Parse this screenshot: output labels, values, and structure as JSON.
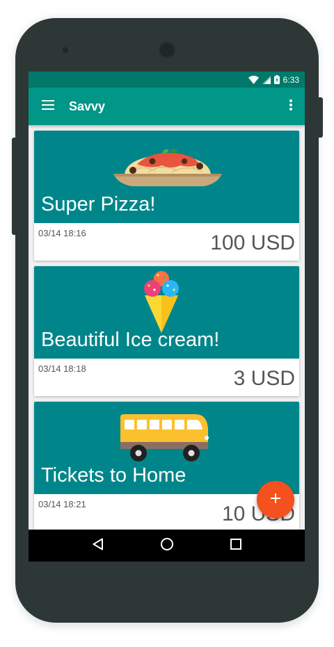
{
  "status_bar": {
    "time": "6:33",
    "icons": [
      "wifi-icon",
      "signal-icon",
      "battery-charging-icon"
    ]
  },
  "app_bar": {
    "title": "Savvy",
    "menu_icon": "hamburger-menu-icon",
    "overflow_icon": "more-vert-icon"
  },
  "cards": [
    {
      "title": "Super Pizza!",
      "date": "03/14 18:16",
      "price": "100 USD",
      "image": "spaghetti-plate-illustration"
    },
    {
      "title": "Beautiful Ice cream!",
      "date": "03/14 18:18",
      "price": "3 USD",
      "image": "ice-cream-cone-illustration"
    },
    {
      "title": "Tickets to Home",
      "date": "03/14 18:21",
      "price": "10 USD",
      "image": "bus-illustration"
    }
  ],
  "fab": {
    "icon": "plus-icon",
    "color": "#f4511e"
  },
  "nav_bar": {
    "icons": [
      "back-icon",
      "home-icon",
      "recents-icon"
    ]
  },
  "colors": {
    "primary": "#009688",
    "primary_dark": "#00796b",
    "card_media": "#00868a",
    "accent": "#f4511e"
  }
}
